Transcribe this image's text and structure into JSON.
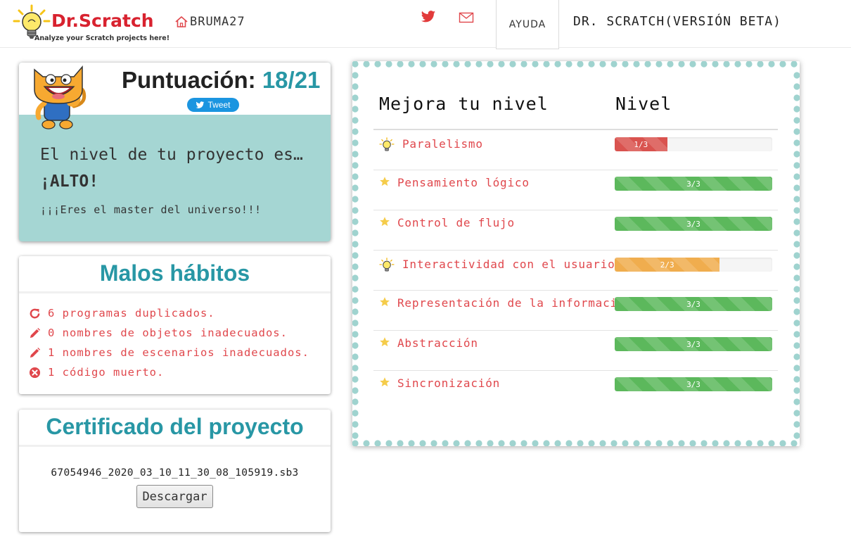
{
  "navbar": {
    "logo_title": "Dr.Scratch",
    "logo_subtitle": "Analyze your Scratch projects here!",
    "home_label": "BRUMA27",
    "help_label": "AYUDA",
    "version_label": "DR. SCRATCH(VERSIÓN BETA)"
  },
  "score": {
    "heading": "Puntuación:",
    "value": "18/21",
    "tweet_label": "Tweet",
    "level_prefix": "El nivel de tu proyecto es…",
    "level_value": "¡ALTO!",
    "praise": "¡¡¡Eres el master del universo!!!"
  },
  "habits": {
    "title": "Malos hábitos",
    "items": [
      {
        "icon": "refresh-icon",
        "text": "6 programas duplicados."
      },
      {
        "icon": "pencil-icon",
        "text": "0 nombres de objetos inadecuados."
      },
      {
        "icon": "pencil-icon",
        "text": "1 nombres de escenarios inadecuados."
      },
      {
        "icon": "close-circle-icon",
        "text": "1 código muerto."
      }
    ]
  },
  "certificate": {
    "title": "Certificado del proyecto",
    "filename": "67054946_2020_03_10_11_30_08_105919.sb3",
    "download_label": "Descargar"
  },
  "levels": {
    "heading_left": "Mejora tu nivel",
    "heading_right": "Nivel",
    "rows": [
      {
        "name": "Paralelismo",
        "icon": "lightbulb-icon",
        "score": 1,
        "max": 3,
        "label": "1/3",
        "color": "#d9534f"
      },
      {
        "name": "Pensamiento lógico",
        "icon": "star-icon",
        "score": 3,
        "max": 3,
        "label": "3/3",
        "color": "#5cb85c"
      },
      {
        "name": "Control de flujo",
        "icon": "star-icon",
        "score": 3,
        "max": 3,
        "label": "3/3",
        "color": "#5cb85c"
      },
      {
        "name": "Interactividad con el usuario",
        "icon": "lightbulb-icon",
        "score": 2,
        "max": 3,
        "label": "2/3",
        "color": "#f0ad4e"
      },
      {
        "name": "Representación de la información",
        "icon": "star-icon",
        "score": 3,
        "max": 3,
        "label": "3/3",
        "color": "#5cb85c"
      },
      {
        "name": "Abstracción",
        "icon": "star-icon",
        "score": 3,
        "max": 3,
        "label": "3/3",
        "color": "#5cb85c"
      },
      {
        "name": "Sincronización",
        "icon": "star-icon",
        "score": 3,
        "max": 3,
        "label": "3/3",
        "color": "#5cb85c"
      }
    ]
  },
  "colors": {
    "accent": "#2897a5",
    "brand_red": "#d8222f",
    "habit_red": "#e0474c",
    "score_panel": "#a5d6d3",
    "dots": "#9fd3cf",
    "twitter": "#1b95e0"
  }
}
